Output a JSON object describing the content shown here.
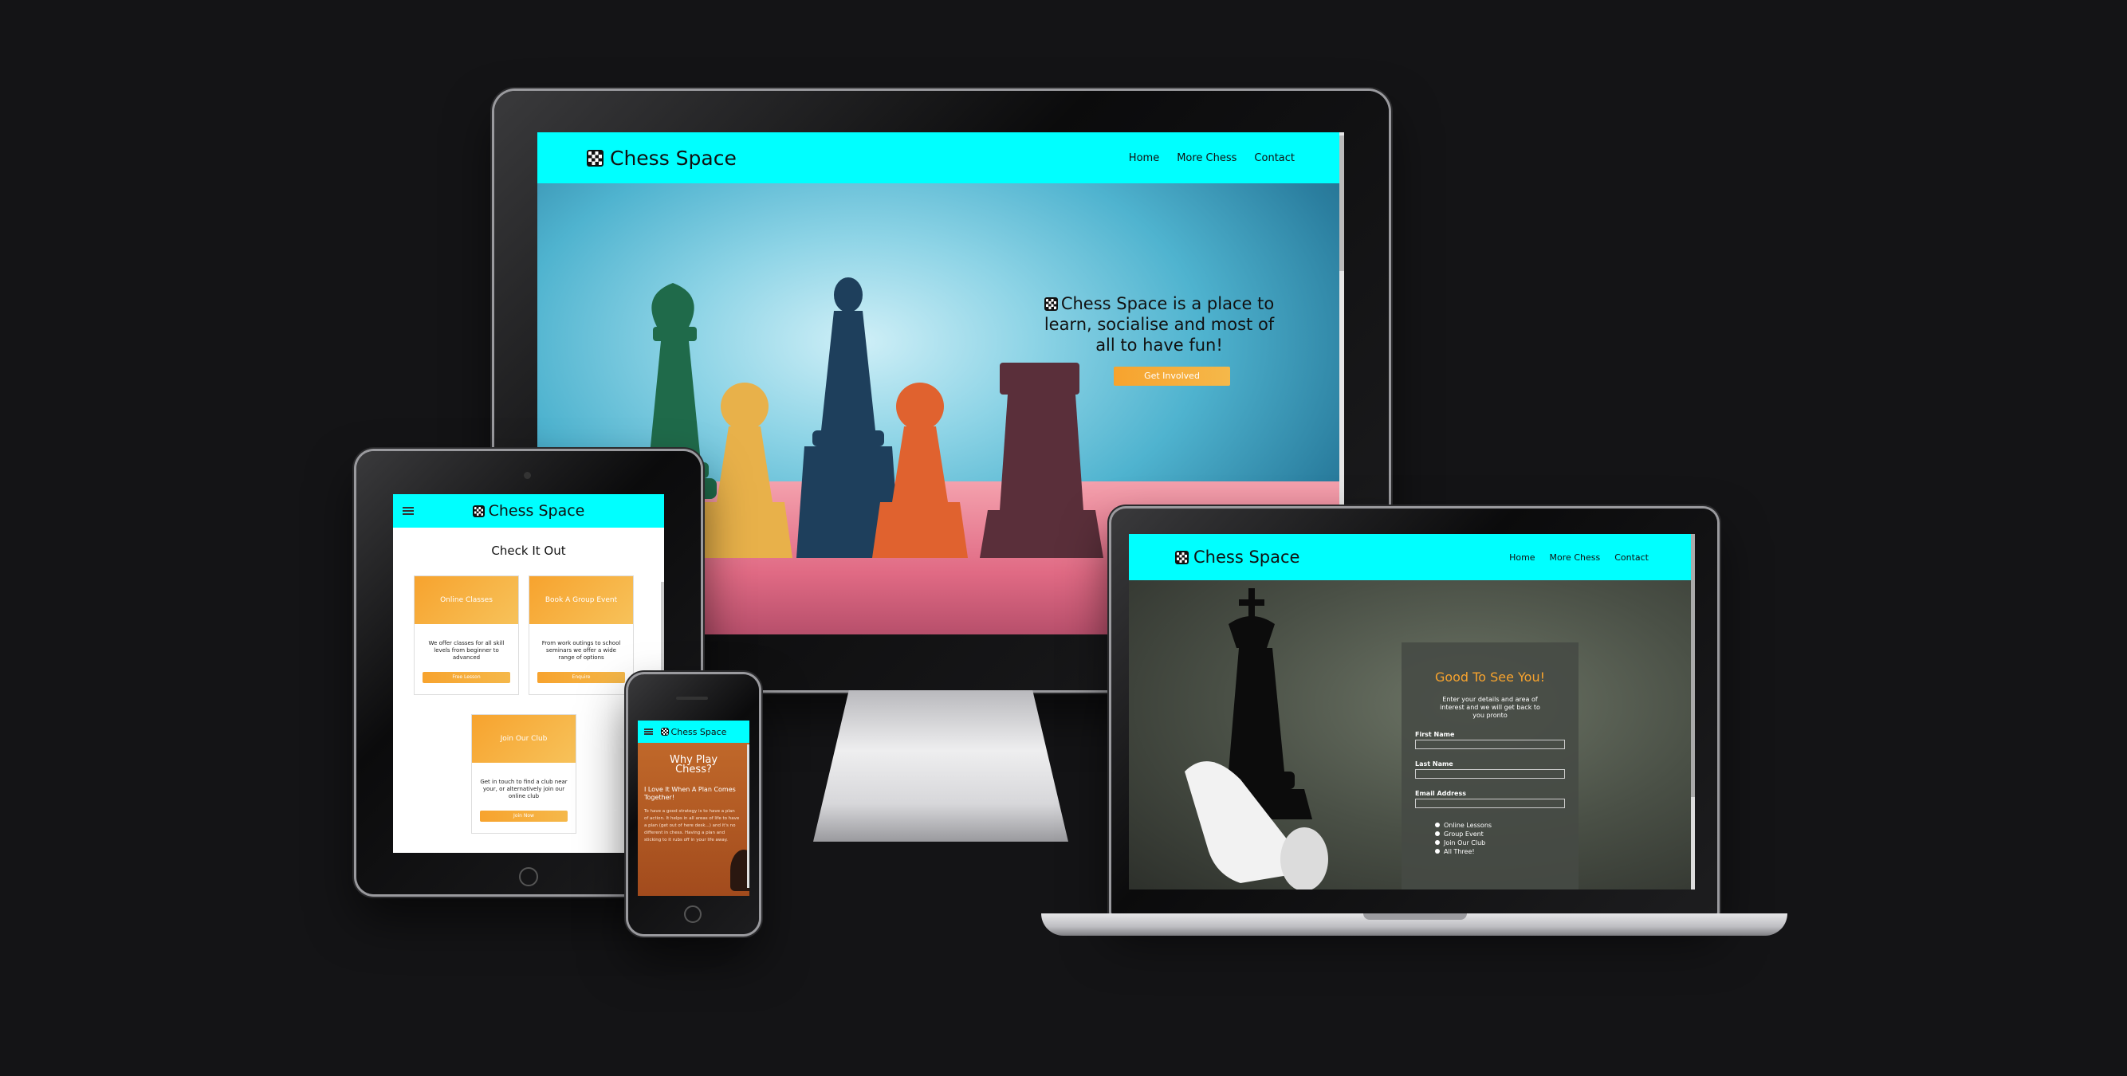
{
  "brand": {
    "name": "Chess Space"
  },
  "desktop": {
    "nav": [
      "Home",
      "More Chess",
      "Contact"
    ],
    "hero_text": "Chess Space is a place to learn, socialise and most of all to have fun!",
    "hero_button": "Get Involved"
  },
  "laptop": {
    "nav": [
      "Home",
      "More Chess",
      "Contact"
    ],
    "form_title": "Good To See You!",
    "form_intro": "Enter your details and area of interest and we will get back to you pronto",
    "fields": [
      "First Name",
      "Last Name",
      "Email Address"
    ],
    "options": [
      "Online Lessons",
      "Group Event",
      "Join Our Club",
      "All Three!"
    ]
  },
  "tablet": {
    "heading": "Check It Out",
    "cards": [
      {
        "title": "Online Classes",
        "text": "We offer classes for all skill levels from beginner to advanced",
        "button": "Free Lesson"
      },
      {
        "title": "Book A Group Event",
        "text": "From work outings to school seminars we offer a wide range of options",
        "button": "Enquire"
      },
      {
        "title": "Join Our Club",
        "text": "Get in touch to find a club near your, or alternatively join our online club",
        "button": "Join Now"
      }
    ]
  },
  "phone": {
    "heading": "Why Play Chess?",
    "subheading": "I Love It When A Plan Comes Together!",
    "body": "To have a good strategy is to have a plan of action. It helps in all areas of life to have a plan (get out of here desk...) and it's no different in chess. Having a plan and sticking to it rubs off in your life away."
  },
  "colors": {
    "nav": "#00ffff",
    "accent": "#f7a32e",
    "background": "#141416"
  }
}
